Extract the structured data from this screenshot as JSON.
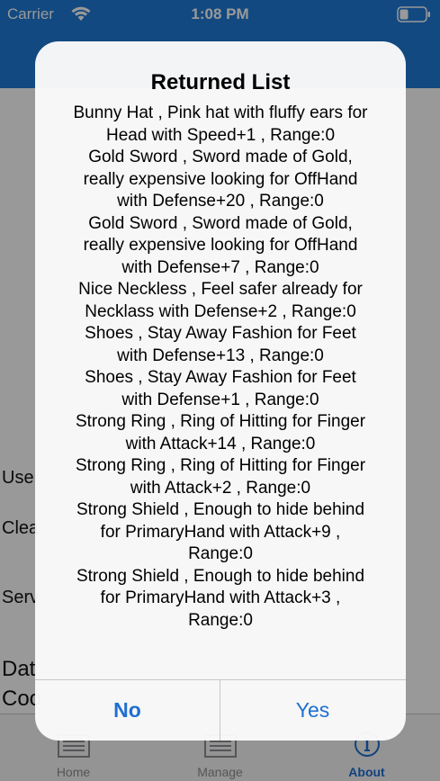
{
  "status_bar": {
    "carrier": "Carrier",
    "time": "1:08 PM"
  },
  "background": {
    "labels": [
      "Use",
      "Clea",
      "Serv",
      "Dat",
      "Coo"
    ]
  },
  "tab_bar": {
    "tabs": [
      {
        "label": "Home",
        "icon": "list-icon",
        "active": false
      },
      {
        "label": "Manage",
        "icon": "list-icon",
        "active": false
      },
      {
        "label": "About",
        "icon": "info-icon",
        "active": true
      }
    ]
  },
  "alert": {
    "title": "Returned List",
    "message_lines": [
      "Bunny Hat , Pink hat with fluffy ears for",
      "Head with Speed+1 , Range:0",
      "Gold Sword , Sword made of Gold,",
      "really expensive looking for OffHand",
      "with Defense+20 , Range:0",
      "Gold Sword , Sword made of Gold,",
      "really expensive looking for OffHand",
      "with Defense+7 , Range:0",
      "Nice Neckless , Feel safer already for",
      "Necklass with Defense+2 , Range:0",
      "Shoes , Stay Away Fashion for Feet",
      "with Defense+13 , Range:0",
      "Shoes , Stay Away Fashion for Feet",
      "with Defense+1 , Range:0",
      "Strong Ring , Ring of Hitting for Finger",
      "with Attack+14 , Range:0",
      "Strong Ring , Ring of Hitting for Finger",
      "with Attack+2 , Range:0",
      "Strong Shield , Enough to hide behind",
      "for PrimaryHand with Attack+9 ,",
      "Range:0",
      "Strong Shield , Enough to hide behind",
      "for PrimaryHand with Attack+3 ,",
      "Range:0"
    ],
    "no_label": "No",
    "yes_label": "Yes"
  },
  "colors": {
    "nav_blue": "#1f7ad6",
    "accent": "#1f6fd1"
  }
}
